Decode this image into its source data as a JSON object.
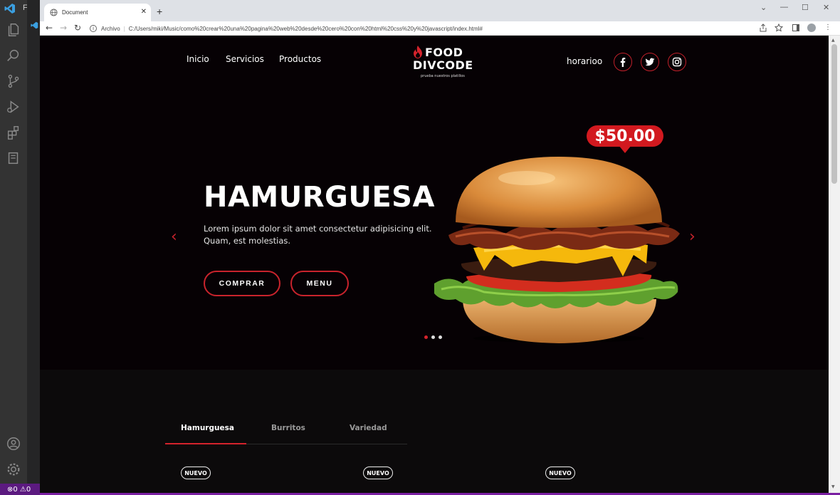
{
  "vscode": {
    "menu_file": "File",
    "status_counts": "⊗0 ⚠0"
  },
  "browser": {
    "tab_title": "Document",
    "tab_close": "✕",
    "new_tab": "+",
    "url_scheme_label": "Archivo",
    "url": "C:/Users/miki/Music/como%20crear%20una%20pagina%20web%20desde%20cero%20con%20html%20css%20y%20javascript/index.html#",
    "back": "←",
    "forward": "→",
    "reload": "↻",
    "win_minimize": "—",
    "win_maximize": "☐",
    "win_close": "✕",
    "menu_chevron": "⌄"
  },
  "nav": {
    "links": [
      "Inicio",
      "Servicios",
      "Productos"
    ],
    "logo_line1": "FOOD",
    "logo_line2": "DIVCODE",
    "logo_tagline": "prueba nuestros platillos",
    "schedule": "horarioo"
  },
  "hero": {
    "title": "HAMURGUESA",
    "description": "Lorem ipsum dolor sit amet consectetur adipisicing elit. Quam, est molestias.",
    "buy_button": "COMPRAR",
    "menu_button": "MENU",
    "price": "$50.00",
    "prev_arrow": "‹",
    "next_arrow": "›",
    "slides": 3,
    "active_slide": 1
  },
  "products": {
    "tabs": [
      "Hamurguesa",
      "Burritos",
      "Variedad"
    ],
    "active_tab": 0,
    "badges": [
      "NUEVO",
      "NUEVO",
      "NUEVO"
    ]
  },
  "colors": {
    "accent": "#d4232c",
    "page_bg": "#060104",
    "vscode_status": "#7a1fa2"
  }
}
